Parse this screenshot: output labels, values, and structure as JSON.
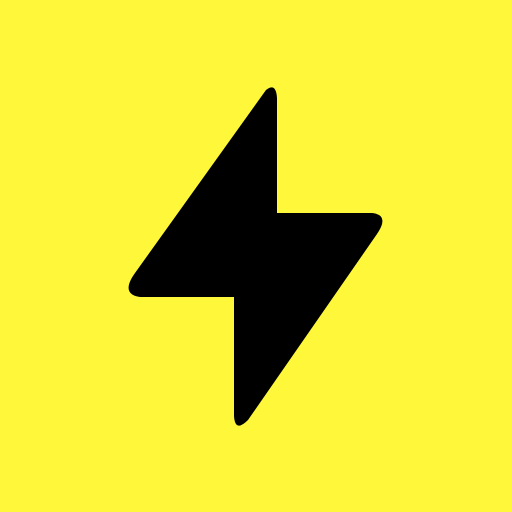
{
  "icon": {
    "name": "lightning-bolt-icon",
    "background_color": "#FFF83A",
    "glyph_color": "#000000"
  }
}
